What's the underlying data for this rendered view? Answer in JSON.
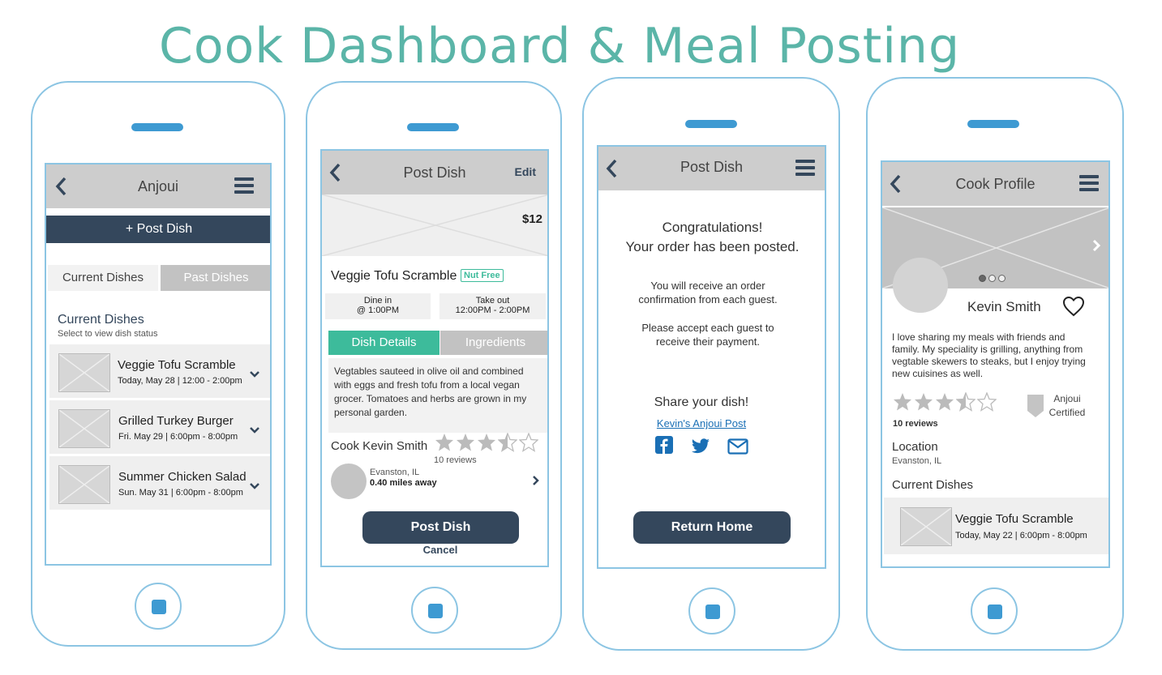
{
  "page_title": "Cook Dashboard & Meal Posting",
  "colors": {
    "accent_teal": "#3dbb9b",
    "navy": "#34475c",
    "phone_outline": "#8cc5e3",
    "link_blue": "#1a6fb5",
    "title_teal": "#5bb5a8"
  },
  "screen1": {
    "header_title": "Anjoui",
    "post_button": "+ Post Dish",
    "tabs": [
      "Current Dishes",
      "Past Dishes"
    ],
    "section_title": "Current Dishes",
    "section_subtitle": "Select to view dish status",
    "dishes": [
      {
        "name": "Veggie Tofu Scramble",
        "when": "Today, May 28 | 12:00 - 2:00pm"
      },
      {
        "name": "Grilled Turkey Burger",
        "when": "Fri. May 29 | 6:00pm - 8:00pm"
      },
      {
        "name": "Summer Chicken Salad",
        "when": "Sun. May 31 | 6:00pm - 8:00pm"
      }
    ]
  },
  "screen2": {
    "header_title": "Post Dish",
    "edit_label": "Edit",
    "price": "$12",
    "dish_name": "Veggie Tofu Scramble",
    "badge": "Nut Free",
    "dine_in_label": "Dine in",
    "dine_in_time": "@ 1:00PM",
    "take_out_label": "Take out",
    "take_out_time": "12:00PM - 2:00PM",
    "tabs": [
      "Dish Details",
      "Ingredients"
    ],
    "description": "Vegtables sauteed in olive oil and combined with eggs and fresh tofu from a local vegan grocer. Tomatoes and herbs are grown in my personal garden.",
    "cook_label": "Cook Kevin Smith",
    "rating": 3.5,
    "reviews": "10 reviews",
    "location": "Evanston, IL",
    "distance": "0.40 miles away",
    "post_button": "Post Dish",
    "cancel": "Cancel"
  },
  "screen3": {
    "header_title": "Post Dish",
    "congrats_line1": "Congratulations!",
    "congrats_line2": "Your order has been posted.",
    "info1_line1": "You will receive an order",
    "info1_line2": "confirmation from each guest.",
    "info2_line1": "Please accept each guest to",
    "info2_line2": "receive their payment.",
    "share_title": "Share your dish!",
    "share_link": "Kevin's Anjoui Post",
    "share_icons": [
      "facebook-icon",
      "twitter-icon",
      "mail-icon"
    ],
    "return_button": "Return Home"
  },
  "screen4": {
    "header_title": "Cook Profile",
    "cook_name": "Kevin Smith",
    "bio": "I love sharing my meals with friends and family. My speciality is grilling, anything from vegtable skewers to steaks, but I enjoy trying new cuisines as well.",
    "rating": 3.5,
    "reviews": "10 reviews",
    "certified_line1": "Anjoui",
    "certified_line2": "Certified",
    "location_title": "Location",
    "location": "Evanston, IL",
    "current_title": "Current Dishes",
    "dish_name": "Veggie Tofu Scramble",
    "dish_when": "Today, May 22 | 6:00pm - 8:00pm",
    "carousel_pages": 3,
    "carousel_active": 1
  }
}
